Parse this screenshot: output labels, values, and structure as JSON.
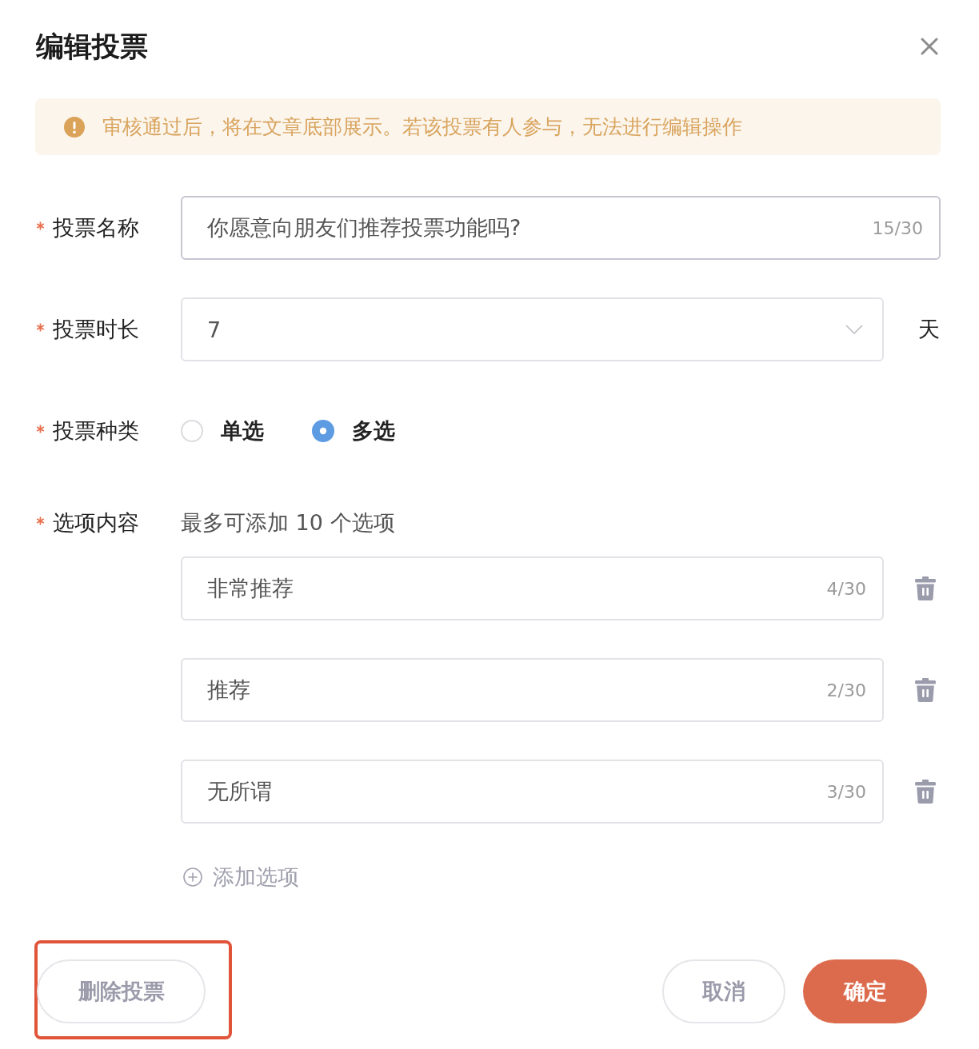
{
  "dialog": {
    "title": "编辑投票"
  },
  "notice": {
    "text": "审核通过后，将在文章底部展示。若该投票有人参与，无法进行编辑操作"
  },
  "fields": [
    {
      "kind": "text",
      "label": "投票名称",
      "required": true,
      "value": "你愿意向朋友们推荐投票功能吗?",
      "counter": "15/30",
      "focused": true
    },
    {
      "kind": "select",
      "label": "投票时长",
      "required": true,
      "value": "7",
      "suffix": "天",
      "focused": false
    },
    {
      "kind": "radio",
      "label": "投票种类",
      "required": true,
      "options": [
        {
          "label": "单选",
          "selected": false
        },
        {
          "label": "多选",
          "selected": true
        }
      ]
    },
    {
      "kind": "choices",
      "label": "选项内容",
      "required": true,
      "hint": "最多可添加 10 个选项",
      "items": [
        {
          "value": "非常推荐",
          "counter": "4/30",
          "focused": false
        },
        {
          "value": "推荐",
          "counter": "2/30",
          "focused": false
        },
        {
          "value": "无所谓",
          "counter": "3/30",
          "focused": false
        }
      ],
      "add_label": "添加选项"
    }
  ],
  "footer": {
    "delete_button": {
      "label": "删除投票",
      "highlighted": true
    },
    "buttons": [
      {
        "label": "取消",
        "kind": "secondary"
      },
      {
        "label": "确定",
        "kind": "primary"
      }
    ]
  }
}
